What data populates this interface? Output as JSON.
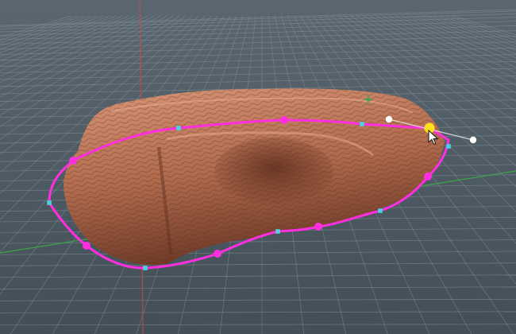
{
  "colors": {
    "background_top": "#5a6770",
    "background_bottom": "#434f57",
    "grid_line": "#8a969d",
    "x_axis": "#3fa34a",
    "y_axis": "#c64b4b",
    "rock_light": "#d99677",
    "rock_mid": "#b06a4c",
    "rock_dark": "#6d3a27",
    "spline": "#ff2fe0",
    "control_point": "#ff2fe0",
    "tangent_handle": "#49d2e0",
    "selected_point": "#ffe11a",
    "handle_end": "#ffffff"
  },
  "icons": {
    "cursor": "arrow-cursor-icon",
    "pivot": "pivot-gizmo-icon"
  }
}
